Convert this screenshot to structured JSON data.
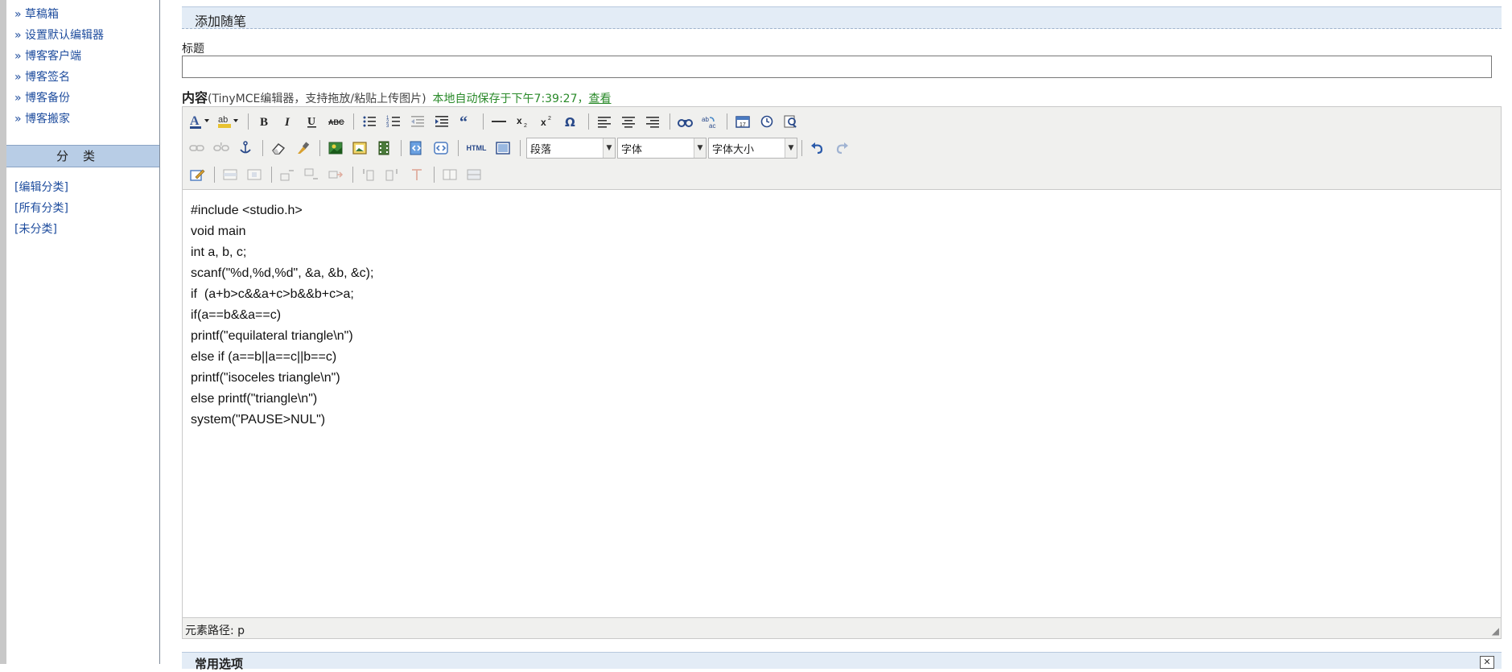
{
  "sidebar": {
    "items": [
      {
        "label": "» 草稿箱"
      },
      {
        "label": "» 设置默认编辑器"
      },
      {
        "label": "» 博客客户端"
      },
      {
        "label": "» 博客签名"
      },
      {
        "label": "» 博客备份"
      },
      {
        "label": "» 博客搬家"
      }
    ],
    "category_header": "分类",
    "category_links": [
      {
        "label": "[编辑分类]"
      },
      {
        "label": "[所有分类]"
      },
      {
        "label": "[未分类]"
      }
    ]
  },
  "main": {
    "section_title": "添加随笔",
    "title_label": "标题",
    "title_value": "",
    "content_label": "内容",
    "content_desc": "(TinyMCE编辑器，支持拖放/粘贴上传图片)",
    "autosave_text": "本地自动保存于下午7:39:27，",
    "autosave_link": "查看",
    "toolbar": {
      "format_select": "段落",
      "font_select": "字体",
      "size_select": "字体大小",
      "html_button": "HTML"
    },
    "editor_lines": [
      "#include <studio.h>",
      "void main",
      "int a, b, c;",
      "scanf(\"%d,%d,%d\", &a, &b, &c);",
      "if  (a+b>c&&a+c>b&&b+c>a;",
      "if(a==b&&a==c)",
      "printf(\"equilateral triangle\\n\")",
      "else if (a==b||a==c||b==c)",
      "printf(\"isoceles triangle\\n\")",
      "else printf(\"triangle\\n\")",
      "system(\"PAUSE>NUL\")"
    ],
    "status_bar": "元素路径: p",
    "options_header": "常用选项"
  }
}
